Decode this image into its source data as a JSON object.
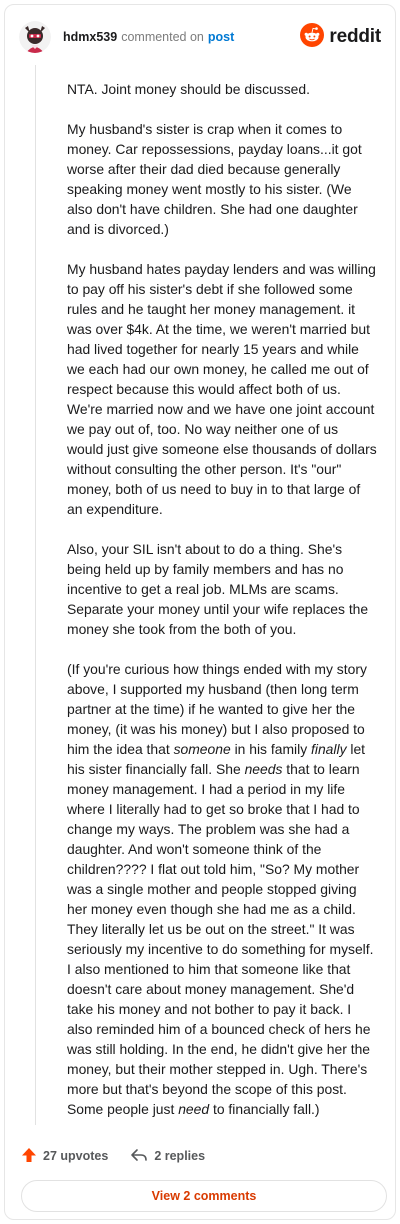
{
  "header": {
    "username": "hdmx539",
    "action": "commented on",
    "post_link": "post",
    "brand": "reddit"
  },
  "comment": {
    "paragraphs": [
      "NTA. Joint money should be discussed.",
      "My husband's sister is crap when it comes to money. Car repossessions, payday loans...it got worse after their dad died because generally speaking money went mostly to his sister. (We also don't have children. She had one daughter and is divorced.)",
      "My husband hates payday lenders and was willing to pay off his sister's debt if she followed some rules and he taught her money management. it was over $4k. At the time, we weren't married but had lived together for nearly 15 years and while we each had our own money, he called me out of respect because this would affect both of us. We're married now and we have one joint account we pay out of, too. No way neither one of us would just give someone else thousands of dollars without consulting the other person. It's \"our\" money, both of us need to buy in to that large of an expenditure.",
      "Also, your SIL isn't about to do a thing. She's being held up by family members and has no incentive to get a real job. MLMs are scams. Separate your money until your wife replaces the money she took from the both of you."
    ],
    "last_paragraph": {
      "s1": "(If you're curious how things ended with my story above, I supported my husband (then long term partner at the time) if he wanted to give her the money, (it was his money) but I also proposed to him the idea that ",
      "em1": "someone",
      "s2": " in his family ",
      "em2": "finally",
      "s3": " let his sister financially fall. She ",
      "em3": "needs",
      "s4": " that to learn money management. I had a period in my life where I literally had to get so broke that I had to change my ways. The problem was she had a daughter. And won't someone think of the children???? I flat out told him, \"So? My mother was a single mother and people stopped giving her money even though she had me as a child. They literally let us be out on the street.\" It was seriously my incentive to do something for myself. I also mentioned to him that someone like that doesn't care about money management. She'd take his money and not bother to pay it back. I also reminded him of a bounced check of hers he was still holding. In the end, he didn't give her the money, but their mother stepped in. Ugh. There's more but that's beyond the scope of this post. Some people just ",
      "em4": "need",
      "s5": " to financially fall.)"
    }
  },
  "footer": {
    "upvotes": "27 upvotes",
    "replies": "2 replies",
    "view_comments": "View 2 comments"
  },
  "colors": {
    "accent": "#d93a00",
    "upvote": "#ff4500",
    "link": "#0079d3"
  },
  "icons": [
    "avatar",
    "reddit-logo-icon",
    "upvote-arrow-icon",
    "reply-icon"
  ]
}
